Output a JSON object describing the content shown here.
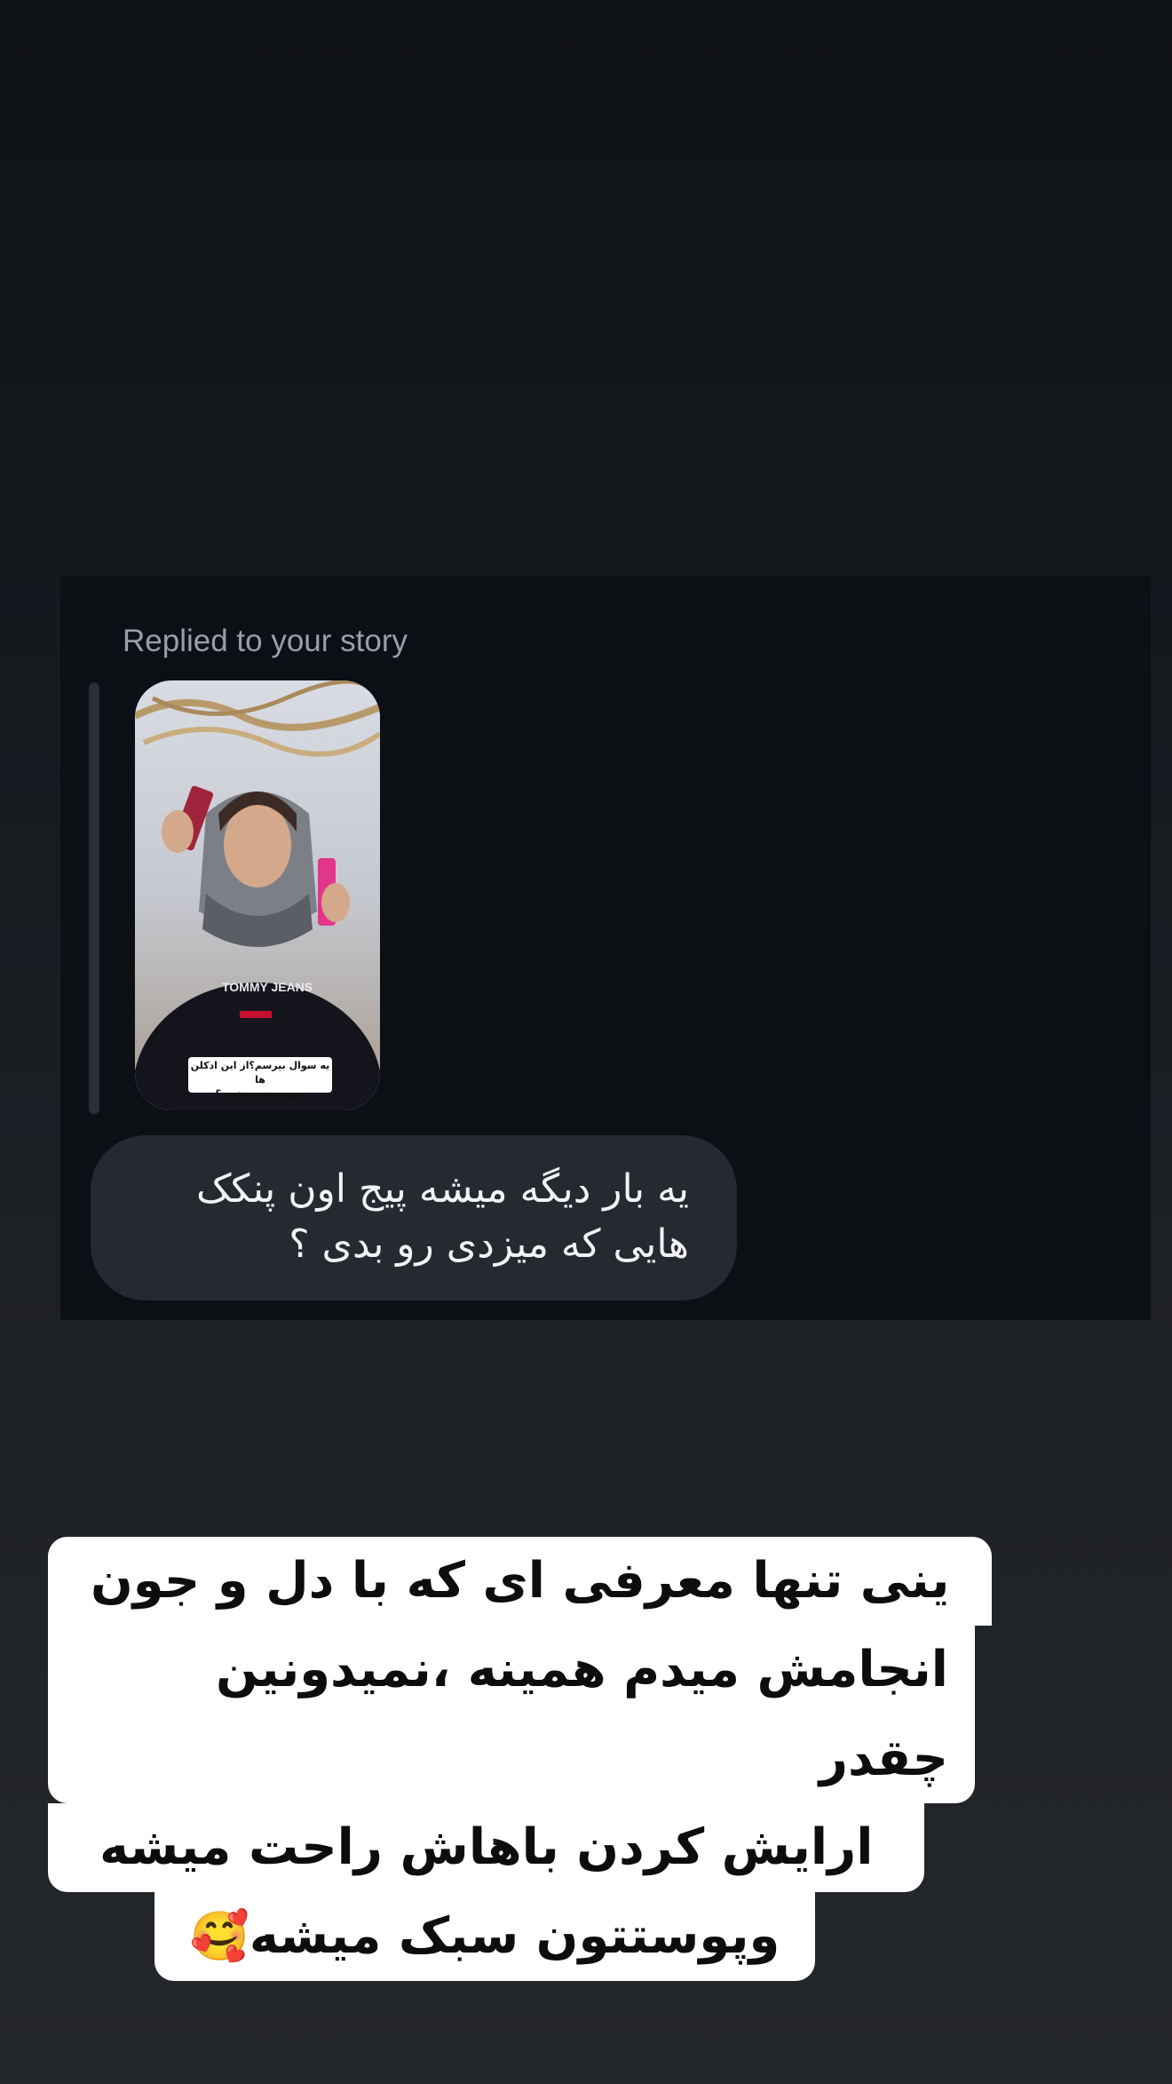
{
  "reply": {
    "caption": "Replied to your story",
    "story": {
      "overlay_line1": "یه سوال بپرسم؟از این ادکلن ها",
      "overlay_line2": "بیرون چند میخری؟"
    },
    "message": "یه بار دیگه میشه پیج اون پنکک هایی که میزدی رو بدی ؟"
  },
  "story_caption": {
    "line1": "ینی تنها معرفی ای که با دل و جون",
    "line2": "انجامش میدم همینه ،نمیدونین چقدر",
    "line3": "ارایش کردن باهاش راحت میشه",
    "line4": "وپوستتون سبک میشه",
    "emoji": "🥰"
  }
}
